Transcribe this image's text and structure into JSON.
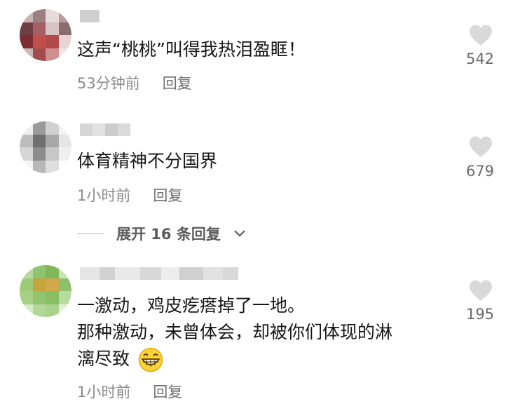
{
  "comments": [
    {
      "text": "这声“桃桃”叫得我热泪盈眶！",
      "time": "53分钟前",
      "reply": "回复",
      "likes": "542",
      "avatar_colors": [
        "#c8b3b6",
        "#9c7f82",
        "#e6dadb",
        "#b99a9d",
        "#6e3f44",
        "#a55e63",
        "#d7c3c4",
        "#8a6b6e",
        "#7b2d33",
        "#c04f4a",
        "#b3484b",
        "#e9d3d4",
        "#c7b6b7",
        "#a34a4d",
        "#d08f8f",
        "#efe6e6"
      ]
    },
    {
      "text": "体育精神不分国界",
      "time": "1小时前",
      "reply": "回复",
      "likes": "679",
      "avatar_colors": [
        "#eeeeee",
        "#9a9a9a",
        "#d0d0d0",
        "#f3f3f3",
        "#bdbdbd",
        "#6f6f6f",
        "#a8a8a8",
        "#e5e5e5",
        "#d6d6d6",
        "#8c8c8c",
        "#c7c7c7",
        "#efefef",
        "#f5f5f5",
        "#b8b8b8",
        "#dedede",
        "#ffffff"
      ]
    },
    {
      "text_lines": [
        "一激动，鸡皮疙瘩掉了一地。",
        "那种激动，未曾体会，却被你们体现的淋",
        "漓尽致"
      ],
      "time": "1小时前",
      "reply": "回复",
      "likes": "195",
      "emoji": "grin-emoji",
      "avatar_colors": [
        "#b7d9a2",
        "#8fc36d",
        "#7fb85b",
        "#c9e3b4",
        "#9ccb78",
        "#c7a33c",
        "#d0a94a",
        "#8cc06b",
        "#a6d083",
        "#91c46f",
        "#88bf66",
        "#b8dba0",
        "#d6ebc8",
        "#b2d797",
        "#a9d28d",
        "#e3f1d9"
      ]
    }
  ],
  "expand": {
    "label": "展开 16 条回复"
  },
  "colors": {
    "text": "#161616",
    "meta": "#8a8a8a",
    "heart": "#d9d9d9"
  }
}
